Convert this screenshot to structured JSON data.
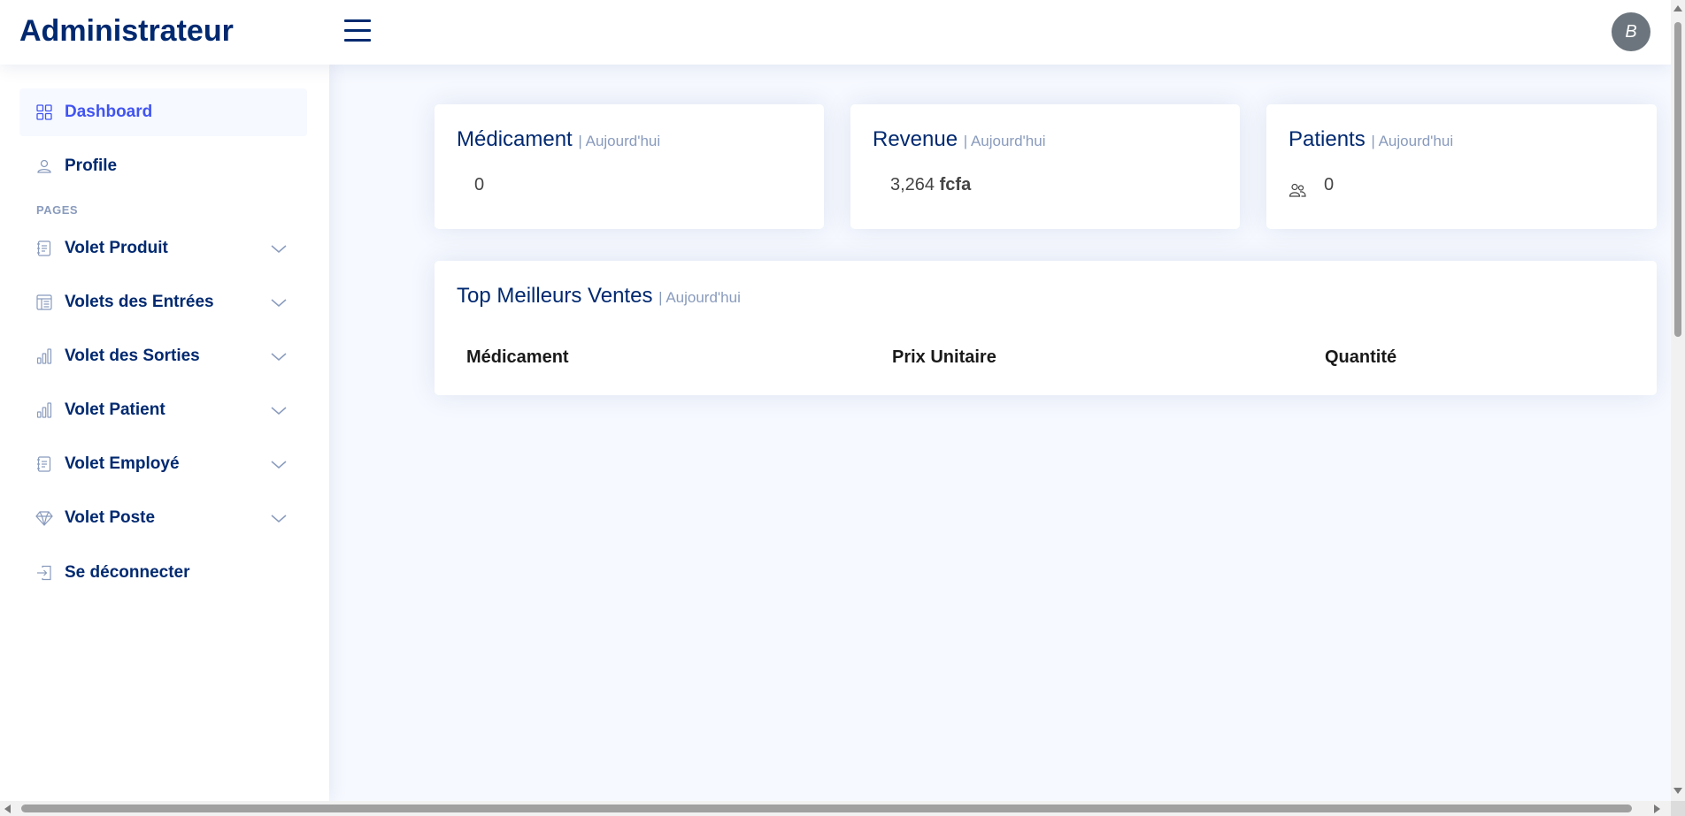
{
  "header": {
    "brand": "Administrateur",
    "menu_icon": "hamburger-icon",
    "avatar_initial": "B"
  },
  "sidebar": {
    "dashboard": "Dashboard",
    "profile": "Profile",
    "section_heading": "PAGES",
    "items": [
      {
        "label": "Volet Produit",
        "icon": "journal-icon"
      },
      {
        "label": "Volets des Entrées",
        "icon": "layout-text-icon"
      },
      {
        "label": "Volet des Sorties",
        "icon": "bar-chart-icon"
      },
      {
        "label": "Volet Patient",
        "icon": "bar-chart-icon"
      },
      {
        "label": "Volet Employé",
        "icon": "journal-icon"
      },
      {
        "label": "Volet Poste",
        "icon": "gem-icon"
      }
    ],
    "logout": "Se déconnecter"
  },
  "cards": {
    "medicament": {
      "title": "Médicament",
      "period": "| Aujourd'hui",
      "value": "0"
    },
    "revenue": {
      "title": "Revenue",
      "period": "| Aujourd'hui",
      "value": "3,264",
      "unit": "fcfa"
    },
    "patients": {
      "title": "Patients",
      "period": "| Aujourd'hui",
      "value": "0"
    }
  },
  "top_sales": {
    "title": "Top Meilleurs Ventes",
    "period": "| Aujourd'hui",
    "columns": [
      "Médicament",
      "Prix Unitaire",
      "Quantité"
    ]
  },
  "colors": {
    "primary": "#012970",
    "accent": "#4154f1",
    "muted": "#899bbd",
    "background": "#f6f9ff"
  }
}
